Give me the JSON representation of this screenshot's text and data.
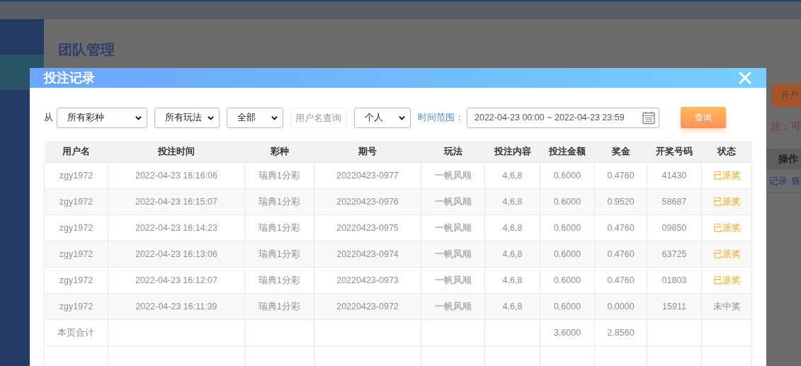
{
  "background": {
    "page_title": "团队管理",
    "action_button": "开户",
    "notice": "注：可",
    "table_header": "操作",
    "row_links": [
      "记录",
      "账"
    ]
  },
  "modal": {
    "title": "投注记录",
    "filters": {
      "from_label": "从",
      "selects": [
        {
          "kind": "lottery",
          "value": "所有彩种"
        },
        {
          "kind": "play",
          "value": "所有玩法"
        },
        {
          "kind": "status",
          "value": "全部"
        }
      ],
      "username": {
        "placeholder": "用户名查询"
      },
      "scope": {
        "value": "个人"
      },
      "time_label": "时间范围：",
      "time_range": {
        "value": "2022-04-23 00:00 ~ 2022-04-23 23:59"
      },
      "search_button": "查询"
    },
    "table": {
      "columns": [
        "用户名",
        "投注时间",
        "彩种",
        "期号",
        "玩法",
        "投注内容",
        "投注金额",
        "奖金",
        "开奖号码",
        "状态"
      ],
      "rows": [
        {
          "cells": [
            "zgy1972",
            "2022-04-23 16:16:06",
            "瑞典1分彩",
            "20220423-0977",
            "一帆风顺",
            "4,6,8",
            "0.6000",
            "0.4760",
            "41430"
          ],
          "status": {
            "text": "已派奖",
            "kind": "paid"
          }
        },
        {
          "cells": [
            "zgy1972",
            "2022-04-23 16:15:07",
            "瑞典1分彩",
            "20220423-0976",
            "一帆风顺",
            "4,6,8",
            "0.6000",
            "0.9520",
            "58687"
          ],
          "status": {
            "text": "已派奖",
            "kind": "paid"
          }
        },
        {
          "cells": [
            "zgy1972",
            "2022-04-23 16:14:23",
            "瑞典1分彩",
            "20220423-0975",
            "一帆风顺",
            "4,6,8",
            "0.6000",
            "0.4760",
            "09850"
          ],
          "status": {
            "text": "已派奖",
            "kind": "paid"
          }
        },
        {
          "cells": [
            "zgy1972",
            "2022-04-23 16:13:06",
            "瑞典1分彩",
            "20220423-0974",
            "一帆风顺",
            "4,6,8",
            "0.6000",
            "0.4760",
            "63725"
          ],
          "status": {
            "text": "已派奖",
            "kind": "paid"
          }
        },
        {
          "cells": [
            "zgy1972",
            "2022-04-23 16:12:07",
            "瑞典1分彩",
            "20220423-0973",
            "一帆风顺",
            "4,6,8",
            "0.6000",
            "0.4760",
            "01803"
          ],
          "status": {
            "text": "已派奖",
            "kind": "paid"
          }
        },
        {
          "cells": [
            "zgy1972",
            "2022-04-23 16:11:39",
            "瑞典1分彩",
            "20220423-0972",
            "一帆风顺",
            "4,6,8",
            "0.6000",
            "0.0000",
            "15911"
          ],
          "status": {
            "text": "未中奖",
            "kind": "lost"
          }
        }
      ],
      "totals": {
        "label": "本页合计",
        "bet_amount": "3.6000",
        "prize": "2.8560"
      }
    }
  }
}
